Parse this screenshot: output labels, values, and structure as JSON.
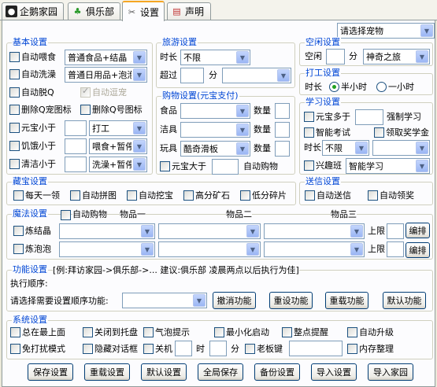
{
  "tabs": [
    {
      "label": "企鹅家园",
      "icon": "penguin-icon"
    },
    {
      "label": "俱乐部",
      "icon": "clover-icon"
    },
    {
      "label": "设置",
      "icon": "tools-icon"
    },
    {
      "label": "声明",
      "icon": "notepad-icon"
    }
  ],
  "pet_select": "请选择宠物",
  "basic": {
    "title": "基本设置",
    "auto_feed": "自动喂食",
    "feed_value": "普通食品+结晶",
    "auto_wash": "自动洗澡",
    "wash_value": "普通日用品+泡泡",
    "auto_detox": "自动脱Q",
    "auto_walk": "自动逗宠",
    "del_qcoin": "删除Q宠图标",
    "del_qnum": "删除Q号图标",
    "yuanbao_less": "元宝小于",
    "yuanbao_action": "打工",
    "hunger_less": "饥饿小于",
    "hunger_action": "喂食+暂停",
    "clean_less": "清洁小于",
    "clean_action": "洗澡+暂停"
  },
  "travel": {
    "title": "旅游设置",
    "duration": "时长",
    "duration_value": "不限",
    "over": "超过",
    "minutes": "分"
  },
  "idle": {
    "title": "空闲设置",
    "idle": "空闲",
    "minutes": "分",
    "idle_value": "神奇之旅"
  },
  "work": {
    "title": "打工设置",
    "duration": "时长",
    "half": "半小时",
    "one": "一小时"
  },
  "shop": {
    "title": "购物设置(元宝支付)",
    "rows": [
      {
        "label": "食品",
        "value": "",
        "qty": "数量"
      },
      {
        "label": "洁具",
        "value": "",
        "qty": "数量"
      },
      {
        "label": "玩具",
        "value": "酷奇滑板",
        "qty": "数量"
      }
    ],
    "yuanbao_more": "元宝大于",
    "auto_shop": "自动购物"
  },
  "study": {
    "title": "学习设置",
    "yuanbao_more": "元宝多于",
    "force": "强制学习",
    "smart_exam": "智能考试",
    "claim_scholar": "领取奖学金",
    "duration": "时长",
    "duration_value": "不限",
    "class": "兴趣班",
    "class_value": "智能学习"
  },
  "treasure": {
    "title": "藏宝设置",
    "items": [
      "每天一领",
      "自动拼图",
      "自动挖宝",
      "高分矿石",
      "低分碎片"
    ]
  },
  "gift": {
    "title": "送信设置",
    "items": [
      "自动送信",
      "自动领奖"
    ]
  },
  "magic": {
    "title": "魔法设置",
    "auto_shop": "自动购物",
    "col1": "物品一",
    "col2": "物品二",
    "col3": "物品三",
    "rows": [
      {
        "label": "炼结晶",
        "limit": "上限",
        "edit": "编排"
      },
      {
        "label": "炼泡泡",
        "limit": "上限",
        "edit": "编排"
      }
    ]
  },
  "func": {
    "title": "功能设置",
    "hint": "[例:拜访家园->俱乐部->... 建议:俱乐部 凌晨两点以后执行为佳]",
    "order": "执行顺序:",
    "choose": "请选择需要设置顺序功能:",
    "btns": [
      "撤消功能",
      "重设功能",
      "重载功能",
      "默认功能"
    ]
  },
  "system": {
    "title": "系统设置",
    "row1": [
      "总在最上面",
      "关闭到托盘",
      "气泡提示",
      "最小化启动",
      "整点提醒",
      "自动升级"
    ],
    "row2": [
      "免打扰模式",
      "隐藏对话框",
      "关机",
      "时",
      "分",
      "老板键",
      "内存整理"
    ]
  },
  "bottom": [
    "保存设置",
    "重载设置",
    "默认设置",
    "全局保存",
    "备份设置",
    "导入设置",
    "导入家园"
  ]
}
